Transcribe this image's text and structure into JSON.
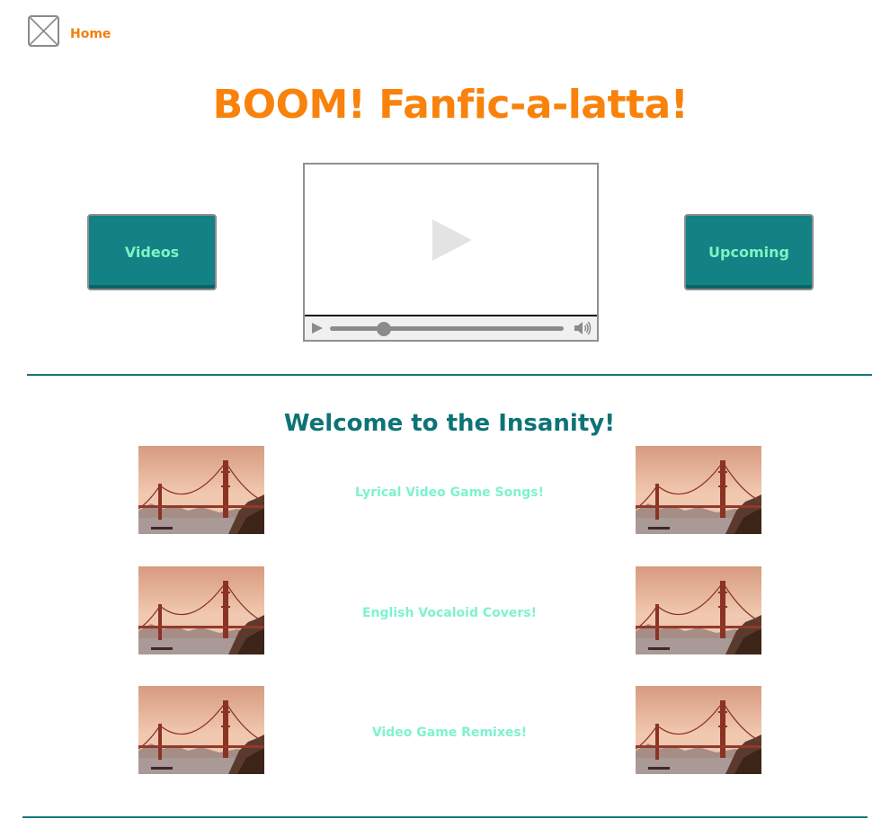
{
  "header": {
    "logo_icon": "placeholder-image-icon",
    "home_label": "Home"
  },
  "hero": {
    "title": "BOOM! Fanfic-a-latta!",
    "title_color": "#F8820B"
  },
  "nav": {
    "videos_label": "Videos",
    "upcoming_label": "Upcoming",
    "button_color": "#128285",
    "button_text_color": "#7FF2C4"
  },
  "video_player": {
    "play_icon": "play-icon",
    "volume_icon": "volume-icon",
    "progress": 0.23
  },
  "section": {
    "title": "Welcome to the Insanity!",
    "title_color": "#0E7376",
    "rows": [
      {
        "label": "Lyrical Video Game Songs!",
        "thumbnail": "golden-gate-bridge-photo"
      },
      {
        "label": "English Vocaloid Covers!",
        "thumbnail": "golden-gate-bridge-photo"
      },
      {
        "label": "Video Game Remixes!",
        "thumbnail": "golden-gate-bridge-photo"
      }
    ],
    "link_color": "#7EF2D0"
  },
  "divider_color": "#14787A"
}
